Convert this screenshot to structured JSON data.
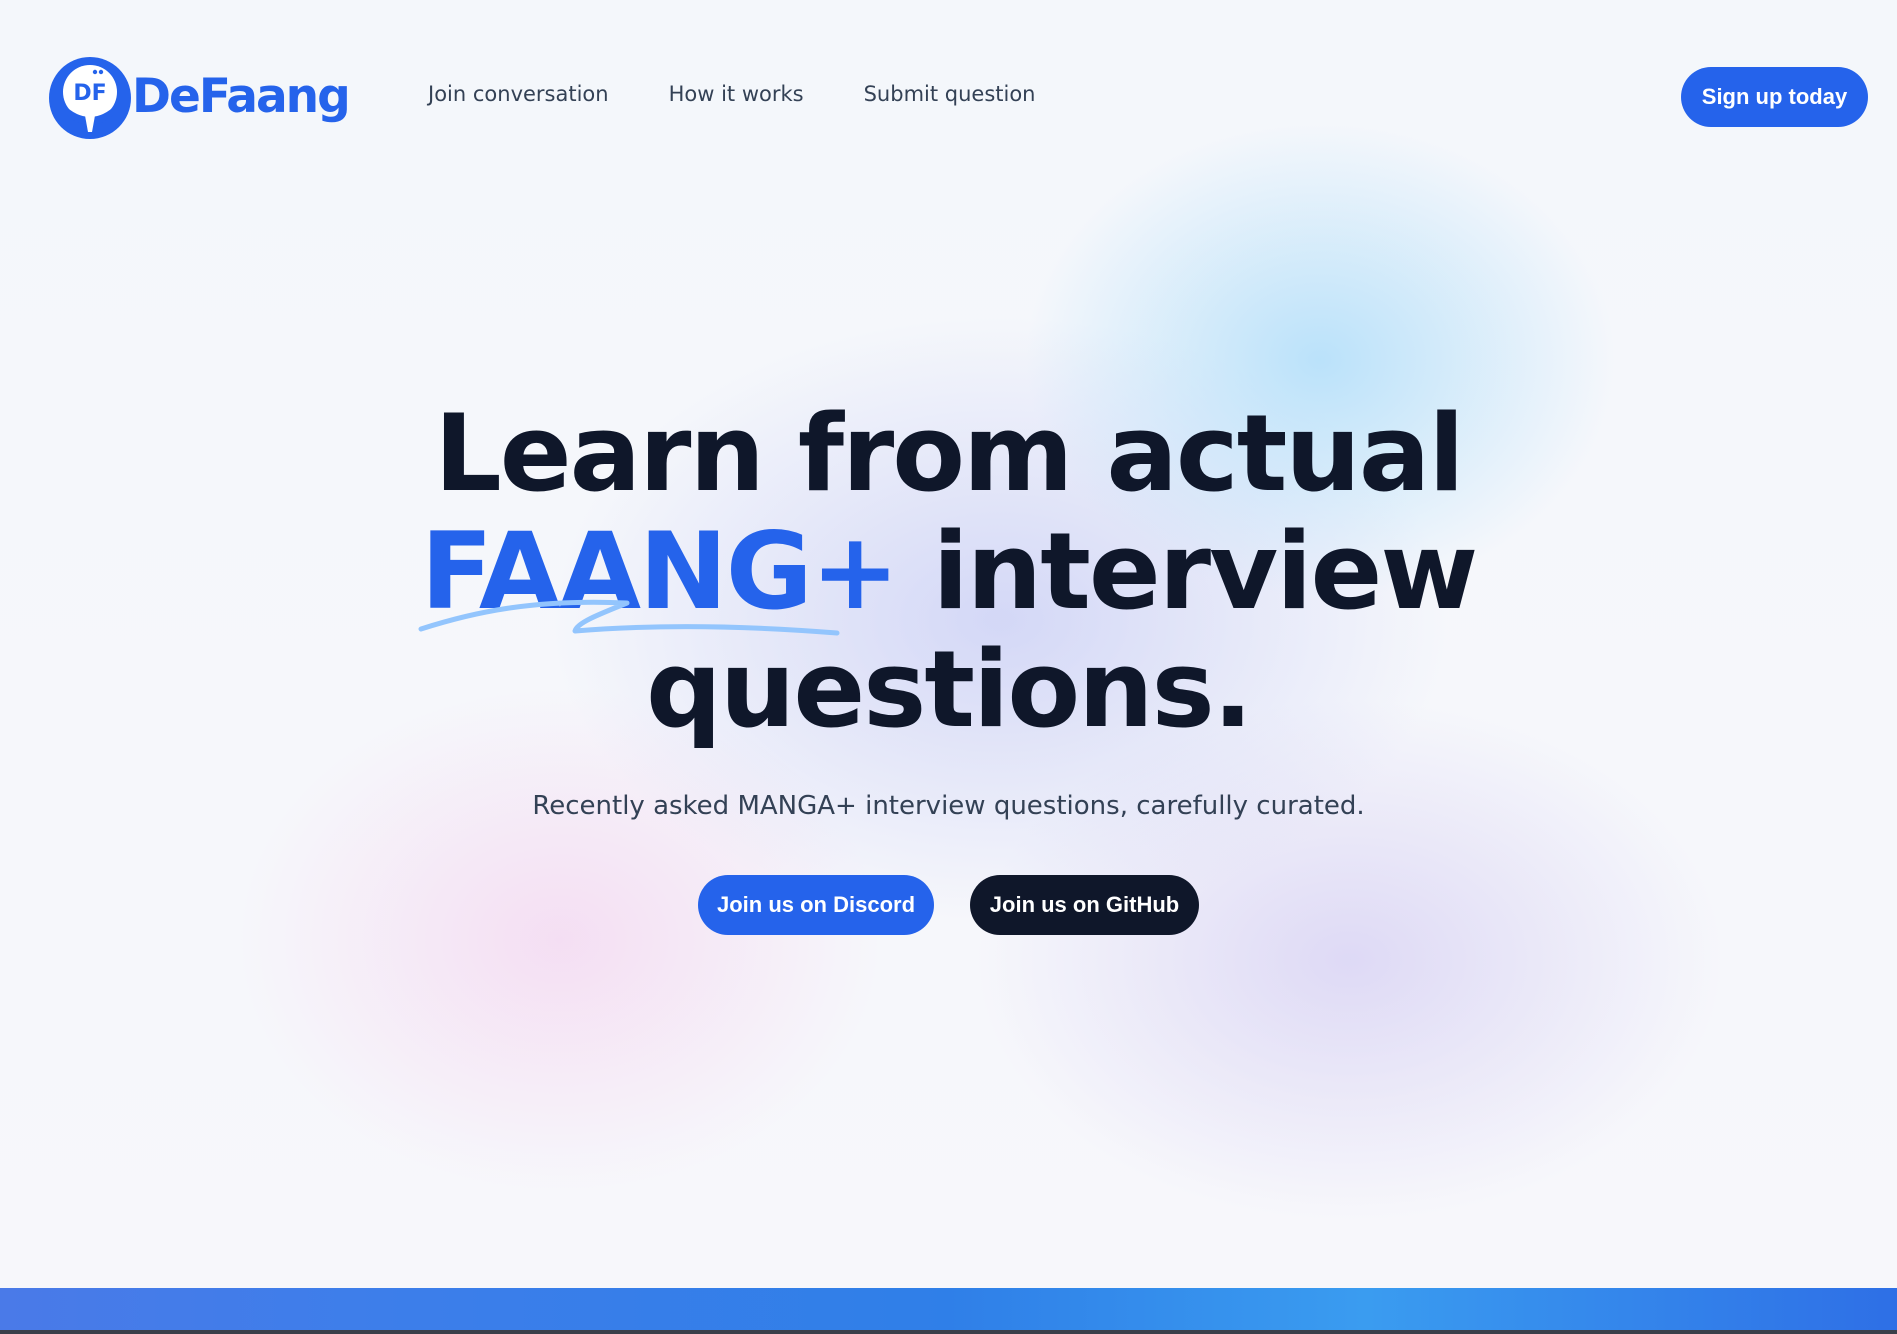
{
  "brand": {
    "name": "DeFaang",
    "monogram": "DF",
    "color": "#2563eb",
    "logo_icon": "defaang-logo-icon"
  },
  "nav": {
    "items": [
      {
        "label": "Join conversation"
      },
      {
        "label": "How it works"
      },
      {
        "label": "Submit question"
      }
    ],
    "signup_label": "Sign up today"
  },
  "hero": {
    "title_line1": "Learn from actual",
    "title_accent": "FAANG+",
    "title_line2_rest": "interview",
    "title_line3": "questions.",
    "subtitle": "Recently asked MANGA+ interview questions, carefully curated.",
    "primary_cta": "Join us on Discord",
    "secondary_cta": "Join us on GitHub"
  },
  "colors": {
    "accent": "#2563eb",
    "dark": "#0f172a",
    "text_muted": "#334155"
  }
}
